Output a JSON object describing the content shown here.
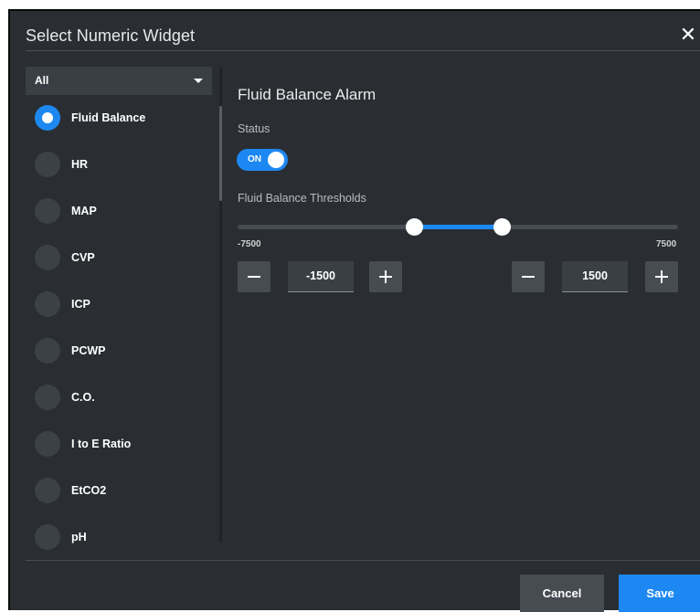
{
  "dialog": {
    "title": "Select Numeric Widget",
    "close_icon": "close-icon"
  },
  "filter": {
    "selected": "All",
    "icon": "chevron-down-icon"
  },
  "list": {
    "items": [
      {
        "label": "Fluid Balance",
        "selected": true
      },
      {
        "label": "HR",
        "selected": false
      },
      {
        "label": "MAP",
        "selected": false
      },
      {
        "label": "CVP",
        "selected": false
      },
      {
        "label": "ICP",
        "selected": false
      },
      {
        "label": "PCWP",
        "selected": false
      },
      {
        "label": "C.O.",
        "selected": false
      },
      {
        "label": "I to E Ratio",
        "selected": false
      },
      {
        "label": "EtCO2",
        "selected": false
      },
      {
        "label": "pH",
        "selected": false
      }
    ]
  },
  "panel": {
    "title": "Fluid Balance Alarm",
    "status_label": "Status",
    "toggle_text": "ON",
    "toggle_on": true,
    "thresholds_label": "Fluid Balance Thresholds",
    "slider": {
      "min": -7500,
      "max": 7500,
      "low": -1500,
      "high": 1500
    },
    "range_min_text": "-7500",
    "range_max_text": "7500",
    "low_value": "-1500",
    "high_value": "1500"
  },
  "footer": {
    "cancel_label": "Cancel",
    "save_label": "Save"
  },
  "colors": {
    "accent": "#1e88f2",
    "background": "#2a2e33",
    "control": "#474c53"
  }
}
